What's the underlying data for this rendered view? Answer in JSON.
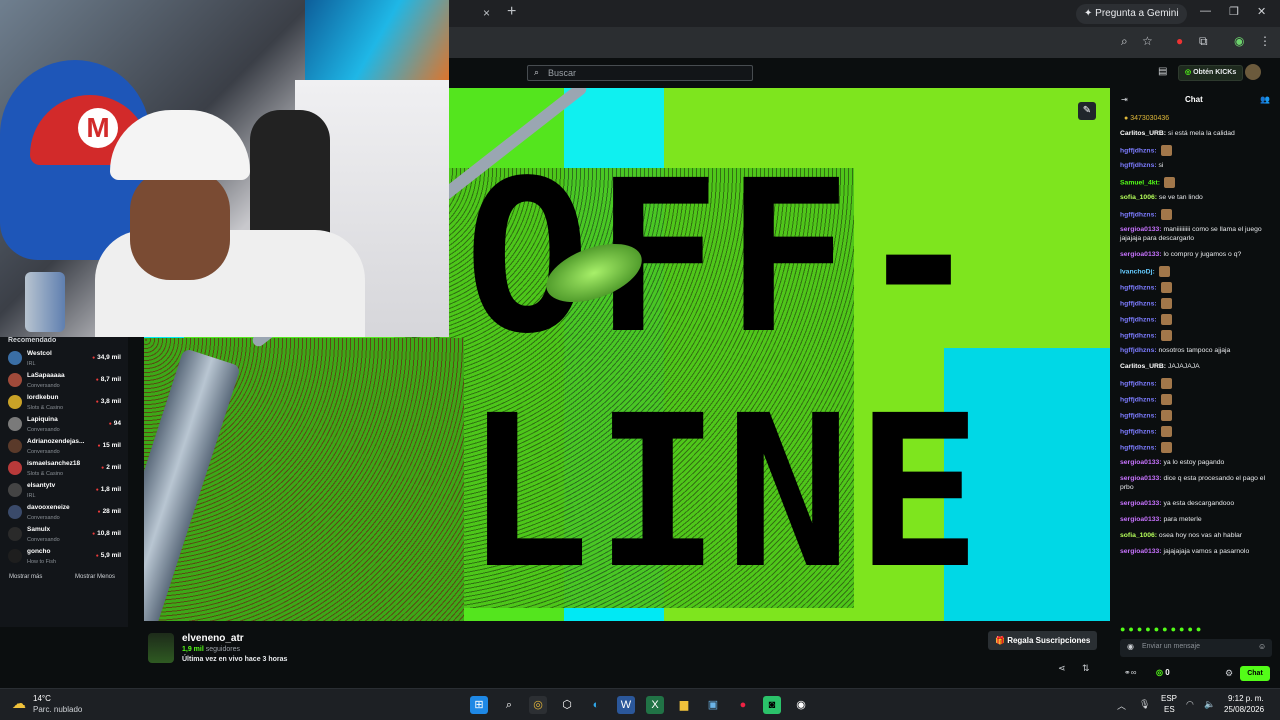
{
  "browser": {
    "gemini_label": "Pregunta a Gemini",
    "new_tab": "+",
    "close_tab": "×"
  },
  "kick": {
    "search_placeholder": "Buscar",
    "kicks_label": "Obtén KICKs"
  },
  "sidebar": {
    "title": "Recomendado",
    "show_more": "Mostrar más",
    "show_less": "Mostrar Menos",
    "items": [
      {
        "name": "Westcol",
        "category": "IRL",
        "viewers": "34,9 mil",
        "color": "#3a6ea5"
      },
      {
        "name": "LaSapaaaaa",
        "category": "Conversando",
        "viewers": "8,7 mil",
        "color": "#a04a3a"
      },
      {
        "name": "lordkebun",
        "category": "Slots & Casino",
        "viewers": "3,8 mil",
        "color": "#c9a227"
      },
      {
        "name": "Lapiquina",
        "category": "Conversando",
        "viewers": "94",
        "color": "#7a7a7a"
      },
      {
        "name": "Adrianozendejas...",
        "category": "Conversando",
        "viewers": "15 mil",
        "color": "#5a3a2a"
      },
      {
        "name": "ismaelsanchez18",
        "category": "Slots & Casino",
        "viewers": "2 mil",
        "color": "#b83a3a"
      },
      {
        "name": "elsantytv",
        "category": "IRL",
        "viewers": "1,8 mil",
        "color": "#444444"
      },
      {
        "name": "davooxeneize",
        "category": "Conversando",
        "viewers": "28 mil",
        "color": "#3a4a6a"
      },
      {
        "name": "Samulx",
        "category": "Conversando",
        "viewers": "10,8 mil",
        "color": "#2a2a2a"
      },
      {
        "name": "goncho",
        "category": "How to Fish",
        "viewers": "5,9 mil",
        "color": "#1e1e1e"
      }
    ]
  },
  "video": {
    "line1": "OFF-",
    "line2": "LINE"
  },
  "channel": {
    "name": "elveneno_atr",
    "followers_count": "1,9 mil",
    "followers_label": "seguidores",
    "last_live": "Última vez en vivo hace 3 horas",
    "gift_label": "Regala Suscripciones"
  },
  "chat": {
    "title": "Chat",
    "pinned": "3473030436",
    "input_placeholder": "Enviar un mensaje",
    "send_label": "Chat",
    "kicks_count": "0",
    "messages": [
      {
        "user": "Carlitos_URB:",
        "text": "si está mela la calidad",
        "color": "#ffffff",
        "emote": false
      },
      {
        "user": "hgffjdhzns:",
        "text": "",
        "color": "#7c7cff",
        "emote": true
      },
      {
        "user": "hgffjdhzns:",
        "text": "si",
        "color": "#7c7cff",
        "emote": false
      },
      {
        "user": "Samuel_4kt:",
        "text": "",
        "color": "#53fc18",
        "emote": true
      },
      {
        "user": "sofia_1006:",
        "text": "se ve tan lindo",
        "color": "#b5ff5a",
        "emote": false
      },
      {
        "user": "hgffjdhzns:",
        "text": "",
        "color": "#7c7cff",
        "emote": true
      },
      {
        "user": "sergioa0133:",
        "text": "maniiiiiiiii como se llama el juego jajajaja para descargarlo",
        "color": "#c873ff",
        "emote": false
      },
      {
        "user": "sergioa0133:",
        "text": "lo compro y jugamos o q?",
        "color": "#c873ff",
        "emote": false
      },
      {
        "user": "IvanchoDj:",
        "text": "",
        "color": "#6cf",
        "emote": true
      },
      {
        "user": "hgffjdhzns:",
        "text": "",
        "color": "#7c7cff",
        "emote": true
      },
      {
        "user": "hgffjdhzns:",
        "text": "",
        "color": "#7c7cff",
        "emote": true
      },
      {
        "user": "hgffjdhzns:",
        "text": "",
        "color": "#7c7cff",
        "emote": true
      },
      {
        "user": "hgffjdhzns:",
        "text": "",
        "color": "#7c7cff",
        "emote": true
      },
      {
        "user": "hgffjdhzns:",
        "text": "nosotros tampoco ajjaja",
        "color": "#7c7cff",
        "emote": false
      },
      {
        "user": "Carlitos_URB:",
        "text": "JAJAJAJA",
        "color": "#ffffff",
        "emote": false
      },
      {
        "user": "hgffjdhzns:",
        "text": "",
        "color": "#7c7cff",
        "emote": true
      },
      {
        "user": "hgffjdhzns:",
        "text": "",
        "color": "#7c7cff",
        "emote": true
      },
      {
        "user": "hgffjdhzns:",
        "text": "",
        "color": "#7c7cff",
        "emote": true
      },
      {
        "user": "hgffjdhzns:",
        "text": "",
        "color": "#7c7cff",
        "emote": true
      },
      {
        "user": "hgffjdhzns:",
        "text": "",
        "color": "#7c7cff",
        "emote": true
      },
      {
        "user": "sergioa0133:",
        "text": "ya lo estoy pagando",
        "color": "#c873ff",
        "emote": false
      },
      {
        "user": "sergioa0133:",
        "text": "dice q esta procesando el pago el prbo",
        "color": "#c873ff",
        "emote": false
      },
      {
        "user": "sergioa0133:",
        "text": "ya esta descargandooo",
        "color": "#c873ff",
        "emote": false
      },
      {
        "user": "sergioa0133:",
        "text": "para meterle",
        "color": "#c873ff",
        "emote": false
      },
      {
        "user": "sofia_1006:",
        "text": "osea hoy nos vas ah hablar",
        "color": "#b5ff5a",
        "emote": false
      },
      {
        "user": "sergioa0133:",
        "text": "jajajajaja vamos a pasarnolo",
        "color": "#c873ff",
        "emote": false
      }
    ]
  },
  "taskbar": {
    "temp": "14°C",
    "weather": "Parc. nublado",
    "lang1": "ESP",
    "lang2": "ES",
    "time": "9:12 p. m.",
    "date": "25/08/2026"
  }
}
